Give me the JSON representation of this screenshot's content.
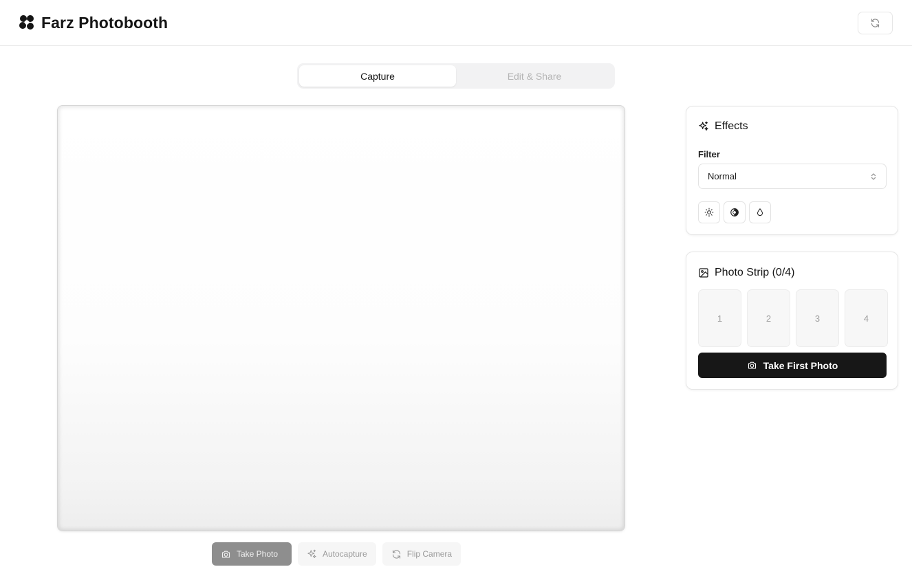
{
  "header": {
    "title": "Farz Photobooth",
    "logo_icon": "paw-flower-logo-icon",
    "refresh_icon": "refresh-icon"
  },
  "tabs": [
    {
      "label": "Capture",
      "active": true
    },
    {
      "label": "Edit & Share",
      "active": false
    }
  ],
  "controls": {
    "take_photo": "Take Photo",
    "autocapture": "Autocapture",
    "flip_camera": "Flip Camera"
  },
  "effects": {
    "title": "Effects",
    "filter_label": "Filter",
    "filter_value": "Normal",
    "adjustments": [
      "brightness-icon",
      "contrast-icon",
      "saturation-icon"
    ]
  },
  "photo_strip": {
    "title": "Photo Strip (0/4)",
    "slots": [
      "1",
      "2",
      "3",
      "4"
    ],
    "cta": "Take First Photo"
  },
  "colors": {
    "primary_dark": "#171717",
    "disabled_button": "#8e8e8e",
    "border": "#e6e6e6"
  }
}
